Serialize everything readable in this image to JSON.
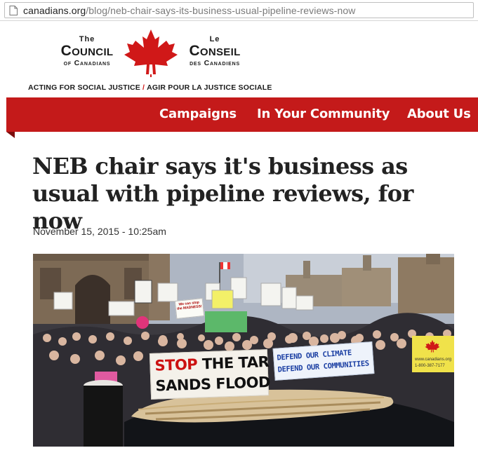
{
  "browser": {
    "url_domain": "canadians.org",
    "url_path": "/blog/neb-chair-says-its-business-usual-pipeline-reviews-now",
    "page_icon": "page-icon"
  },
  "logo": {
    "en_top": "The",
    "en_big": "Council",
    "en_bottom": "of Canadians",
    "fr_top": "Le",
    "fr_big": "Conseil",
    "fr_bottom": "des Canadiens",
    "tagline_en": "ACTING FOR SOCIAL JUSTICE",
    "tagline_slash": "/",
    "tagline_fr": "AGIR POUR LA JUSTICE SOCIALE",
    "leaf_icon": "maple-leaf-icon",
    "brand_red": "#d01818"
  },
  "nav": {
    "background": "#c41a1a",
    "items": [
      {
        "label": "Campaigns"
      },
      {
        "label": "In Your Community"
      },
      {
        "label": "About Us"
      }
    ]
  },
  "article": {
    "title": "NEB chair says it's business as usual with pipeline reviews, for now",
    "date": "November 15, 2015 - 10:25am",
    "photo": {
      "banner_stop_word": "STOP",
      "banner_stop_rest": "THE TAR",
      "banner_stop_line2": "SANDS FLOOD",
      "banner_defend_line1": "DEFEND OUR CLIMATE",
      "banner_defend_line2": "DEFEND OUR COMMUNITIES",
      "sign_madness": "We can stop the MADNESS!",
      "council_site": "www.canadians.org",
      "council_phone": "1-800-387-7177"
    }
  }
}
